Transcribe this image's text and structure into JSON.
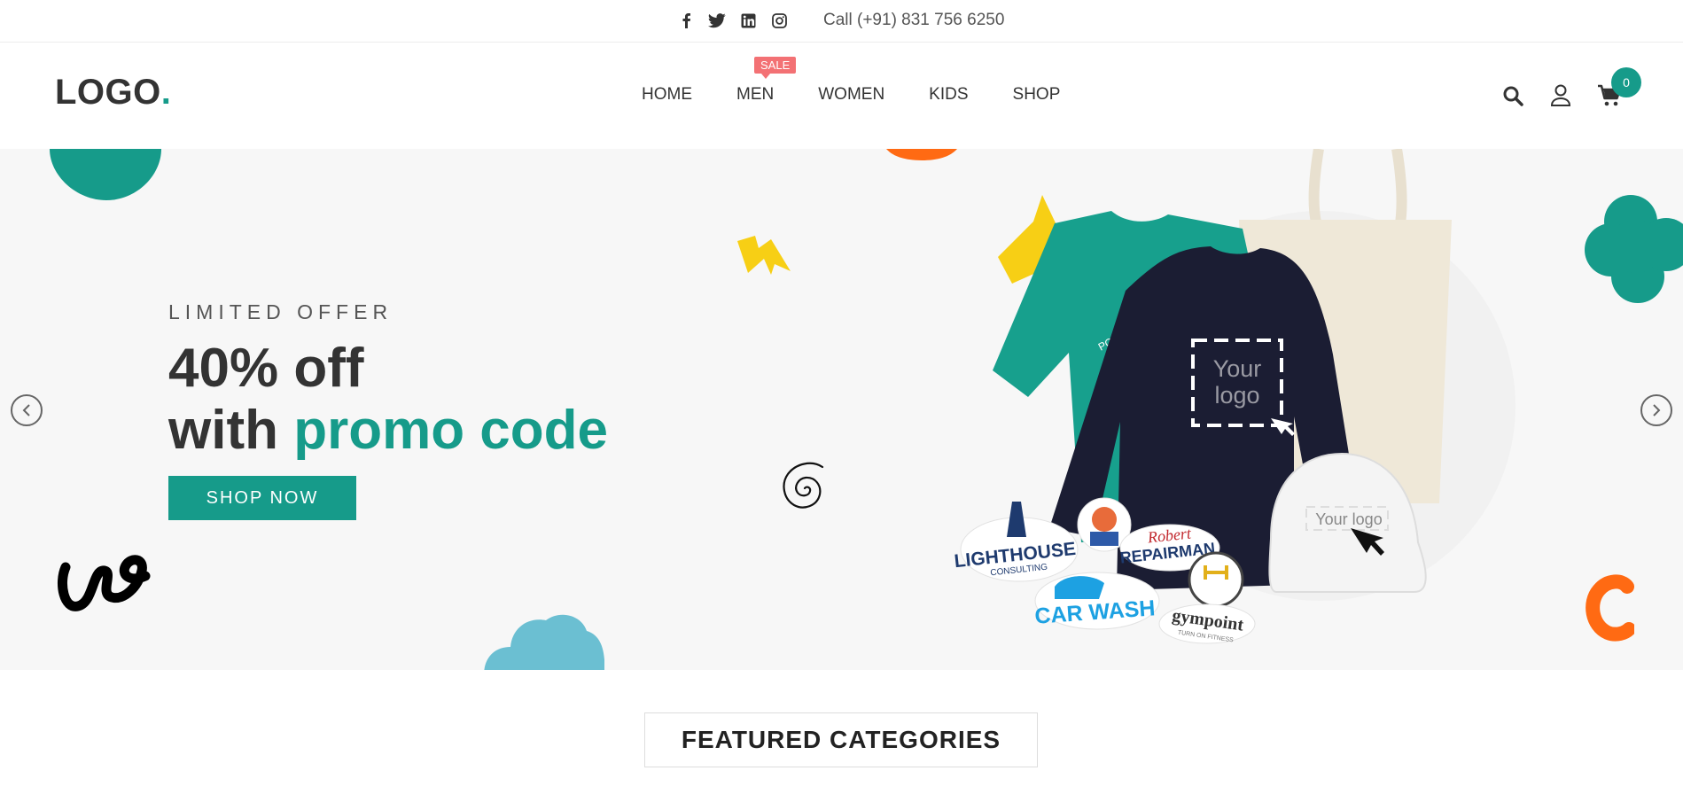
{
  "topbar": {
    "social_icons": [
      "facebook-icon",
      "twitter-icon",
      "linkedin-icon",
      "instagram-icon"
    ],
    "phone": "Call (+91) 831 756 6250"
  },
  "header": {
    "logo_text": "LOGO",
    "logo_dot": ".",
    "nav": [
      {
        "label": "HOME"
      },
      {
        "label": "MEN",
        "badge": "SALE"
      },
      {
        "label": "WOMEN"
      },
      {
        "label": "KIDS"
      },
      {
        "label": "SHOP"
      }
    ],
    "actions": [
      "search-icon",
      "user-icon",
      "cart-icon"
    ],
    "cart_count": "0"
  },
  "hero": {
    "eyebrow": "LIMITED OFFER",
    "headline_line1": "40% off",
    "headline_line2_prefix": "with ",
    "headline_line2_accent": "promo code",
    "cta": "SHOP NOW",
    "image_texts": {
      "sweater_logo_line1": "Your",
      "sweater_logo_line2": "logo",
      "cap_logo": "Your logo",
      "tshirt_brand": "POWERUP",
      "sticker_lighthouse": "LIGHTHOUSE",
      "sticker_lighthouse_sub": "CONSULTING",
      "sticker_repairman_1": "Robert",
      "sticker_repairman_2": "REPAIRMAN",
      "sticker_carwash": "CAR WASH",
      "sticker_gym": "gympoint",
      "sticker_gym_sub": "TURN ON FITNESS"
    }
  },
  "featured": {
    "title": "FEATURED CATEGORIES"
  },
  "colors": {
    "accent": "#169b8a",
    "sale": "#f37174",
    "hero_bg": "#f7f7f7",
    "navy": "#1b1d33",
    "orange": "#ff6a13",
    "yellow": "#f7cf15",
    "blue_cloud": "#6bbfd2"
  }
}
